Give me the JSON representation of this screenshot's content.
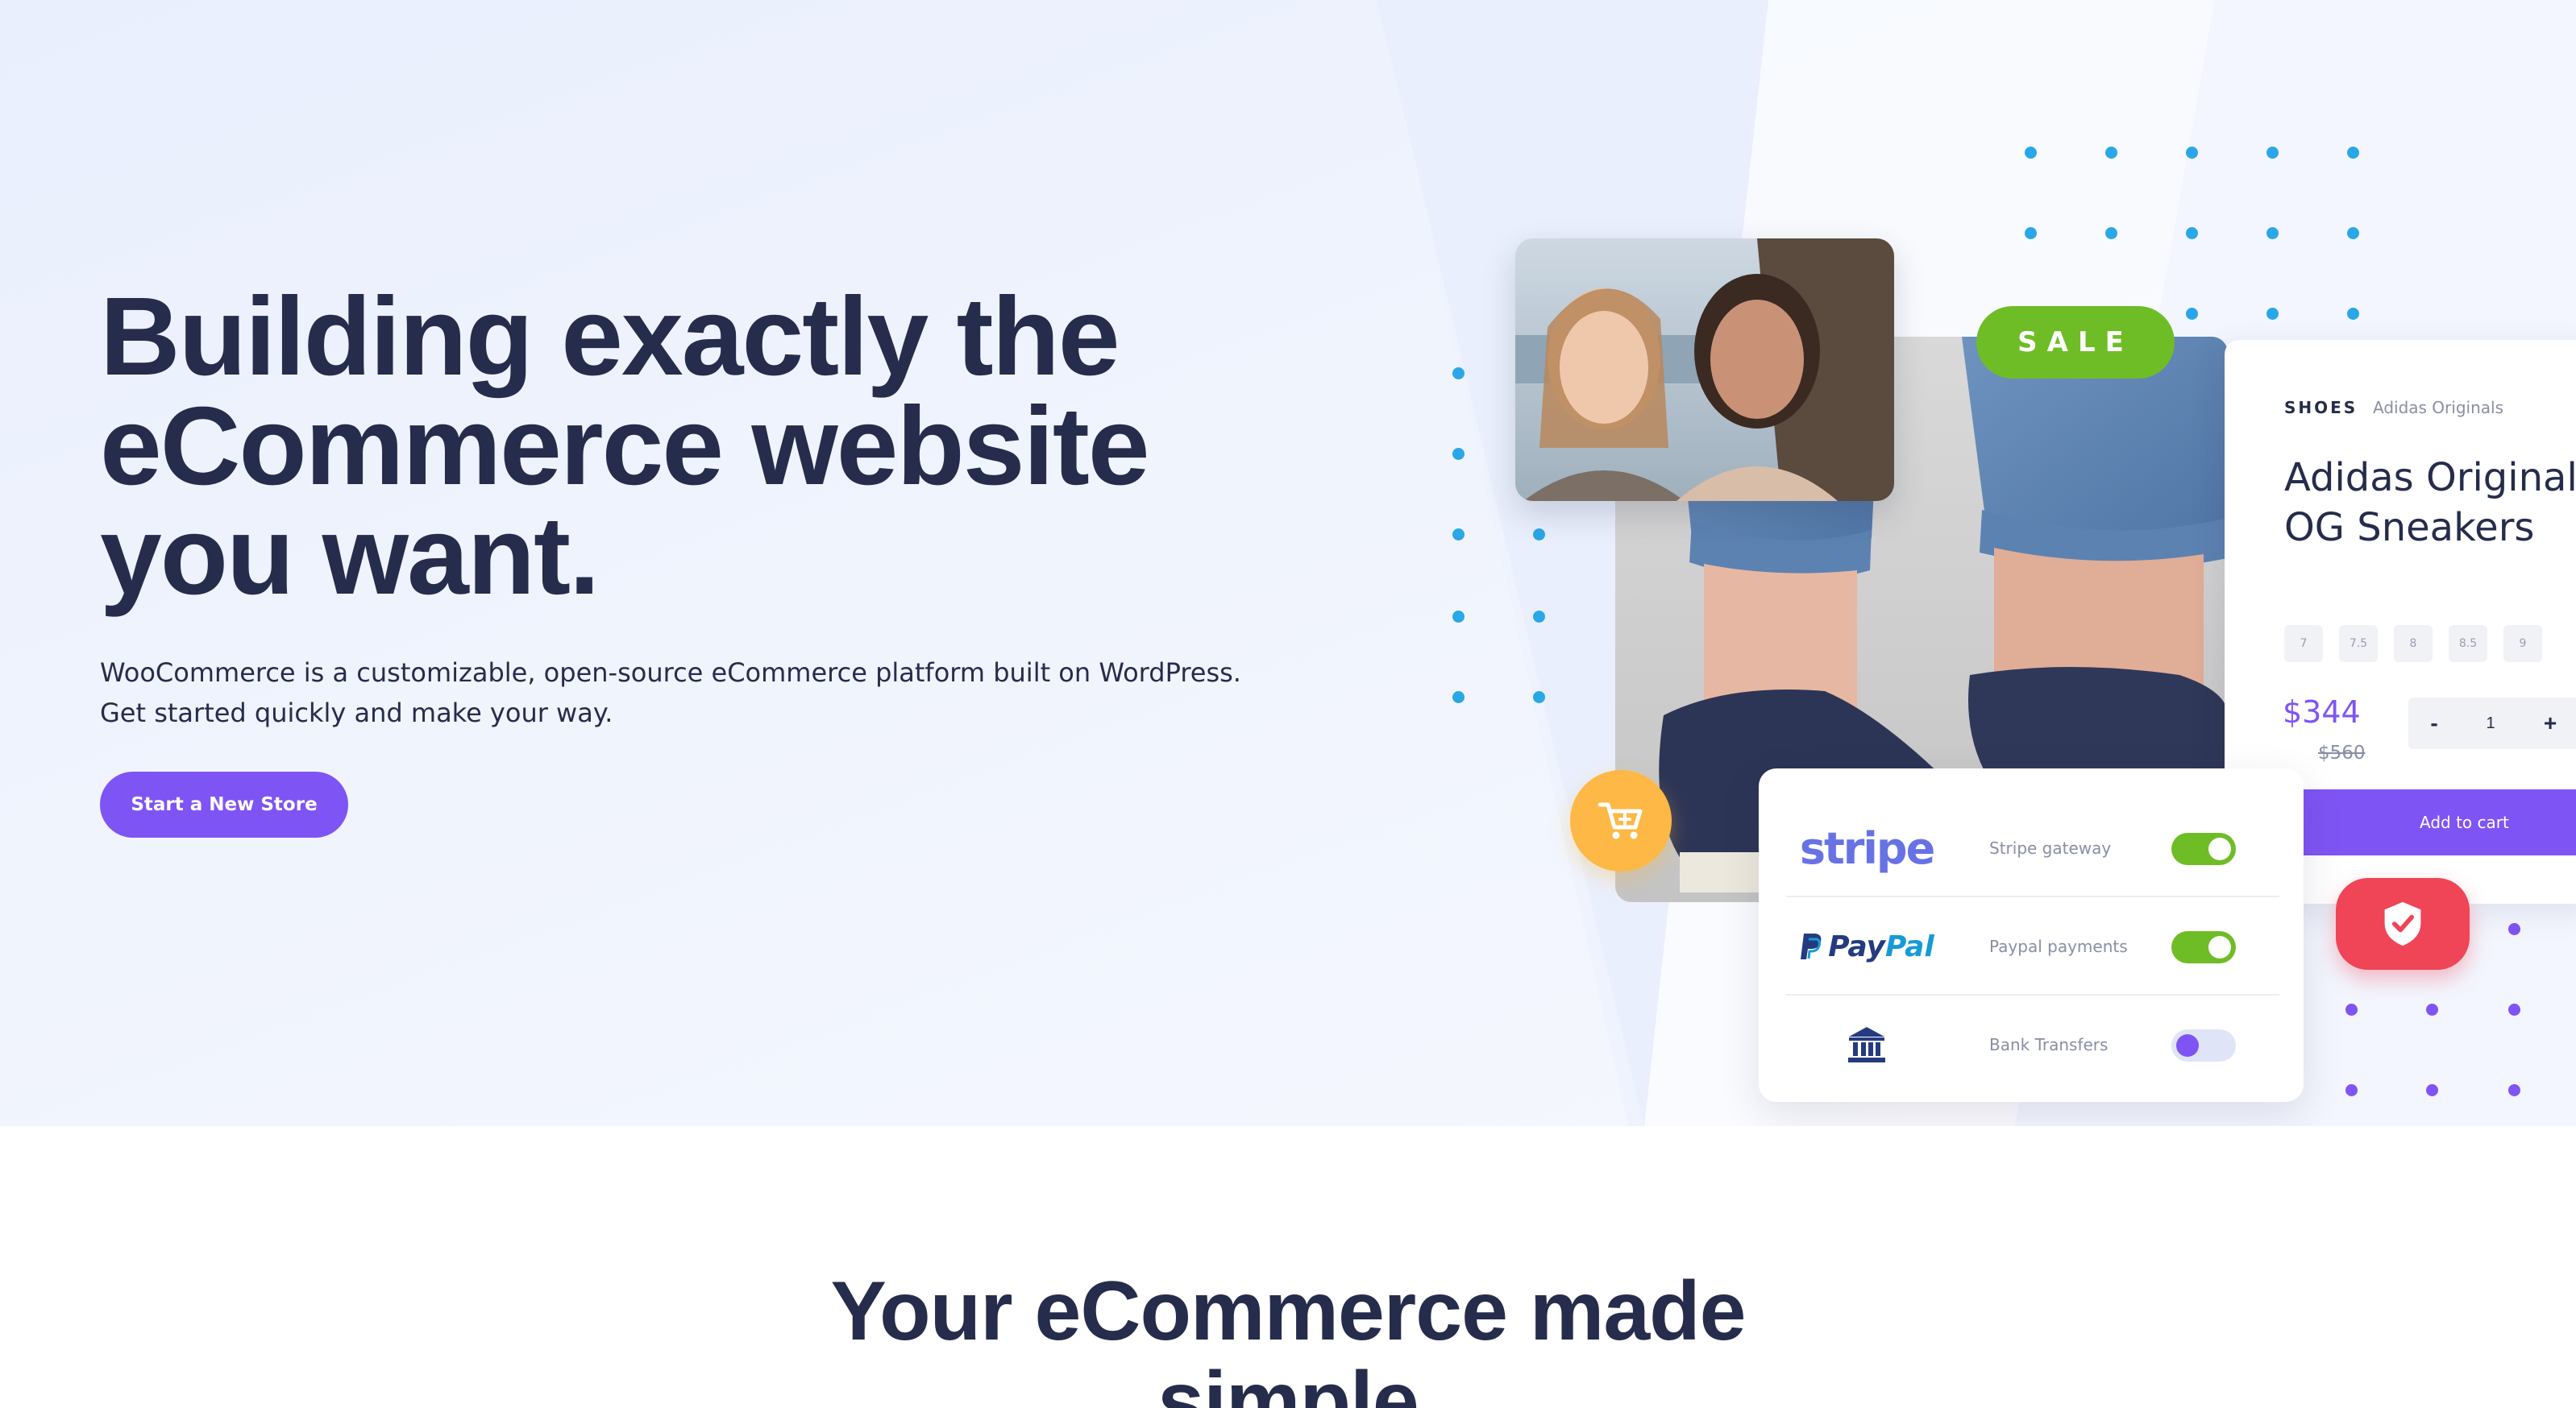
{
  "hero": {
    "headline": "Building exactly the eCommerce website you want.",
    "lead": "WooCommerce is a customizable, open-source eCommerce platform built on WordPress. Get started quickly and make your way.",
    "cta_label": "Start a New Store"
  },
  "illustration": {
    "sale_badge": "SALE",
    "product": {
      "category": "SHOES",
      "brand": "Adidas Originals",
      "title_line1": "Adidas Originals",
      "title_line2": "OG Sneakers",
      "sizes": [
        "7",
        "7.5",
        "8",
        "8.5",
        "9"
      ],
      "price": "$344",
      "old_price": "$560",
      "qty_minus": "-",
      "quantity": "1",
      "qty_plus": "+",
      "add_to_cart": "Add to cart"
    },
    "payments": [
      {
        "logo_text": "stripe",
        "label": "Stripe gateway",
        "enabled": true
      },
      {
        "logo_text_1": "Pay",
        "logo_text_2": "Pal",
        "label": "Paypal payments",
        "enabled": true
      },
      {
        "icon": "bank-icon",
        "label": "Bank Transfers",
        "enabled": false
      }
    ],
    "icons": [
      "cart-plus-icon",
      "shield-check-icon",
      "bank-icon"
    ],
    "colors": {
      "accent": "#7f54f4",
      "sale_green": "#6fbd26",
      "cart_yellow": "#fdb845",
      "shield_red": "#ef4557",
      "dot_blue": "#2aa7e8",
      "heading": "#262c4b"
    }
  },
  "section": {
    "title": "Your eCommerce made\nsimple"
  }
}
